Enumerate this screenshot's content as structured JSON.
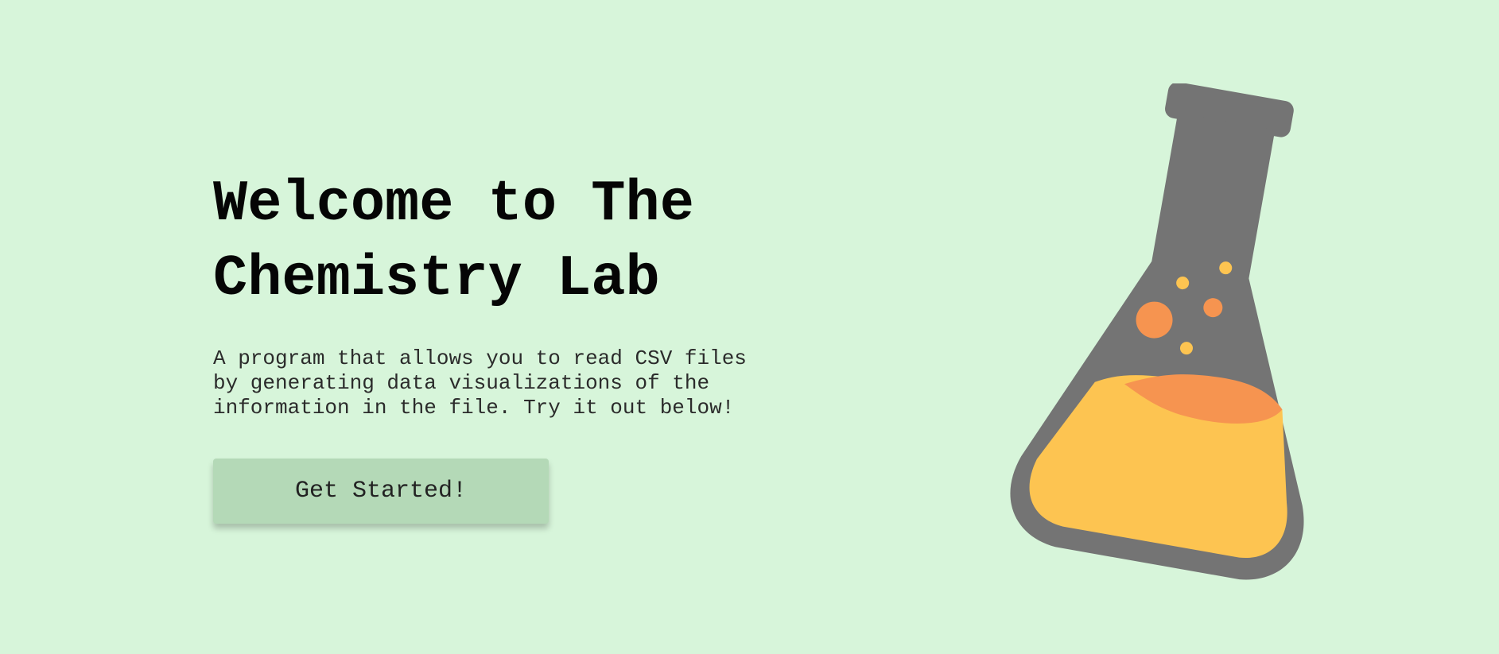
{
  "hero": {
    "title_line1": "Welcome to The",
    "title_line2": "Chemistry Lab",
    "description_line1": "A program that allows you to read CSV files",
    "description_line2": "by generating data visualizations of the",
    "description_line3": "information in the file. Try it out below!",
    "cta_label": "Get Started!"
  },
  "illustration": {
    "icon": "chemistry-flask-icon"
  },
  "colors": {
    "background": "#d7f5da",
    "button": "#b4d9b7",
    "flask_glass": "#747474",
    "liquid": "#fdc451",
    "liquid_top": "#f69450",
    "bubbles_small": "#fdc451",
    "bubbles_orange": "#f69450"
  }
}
